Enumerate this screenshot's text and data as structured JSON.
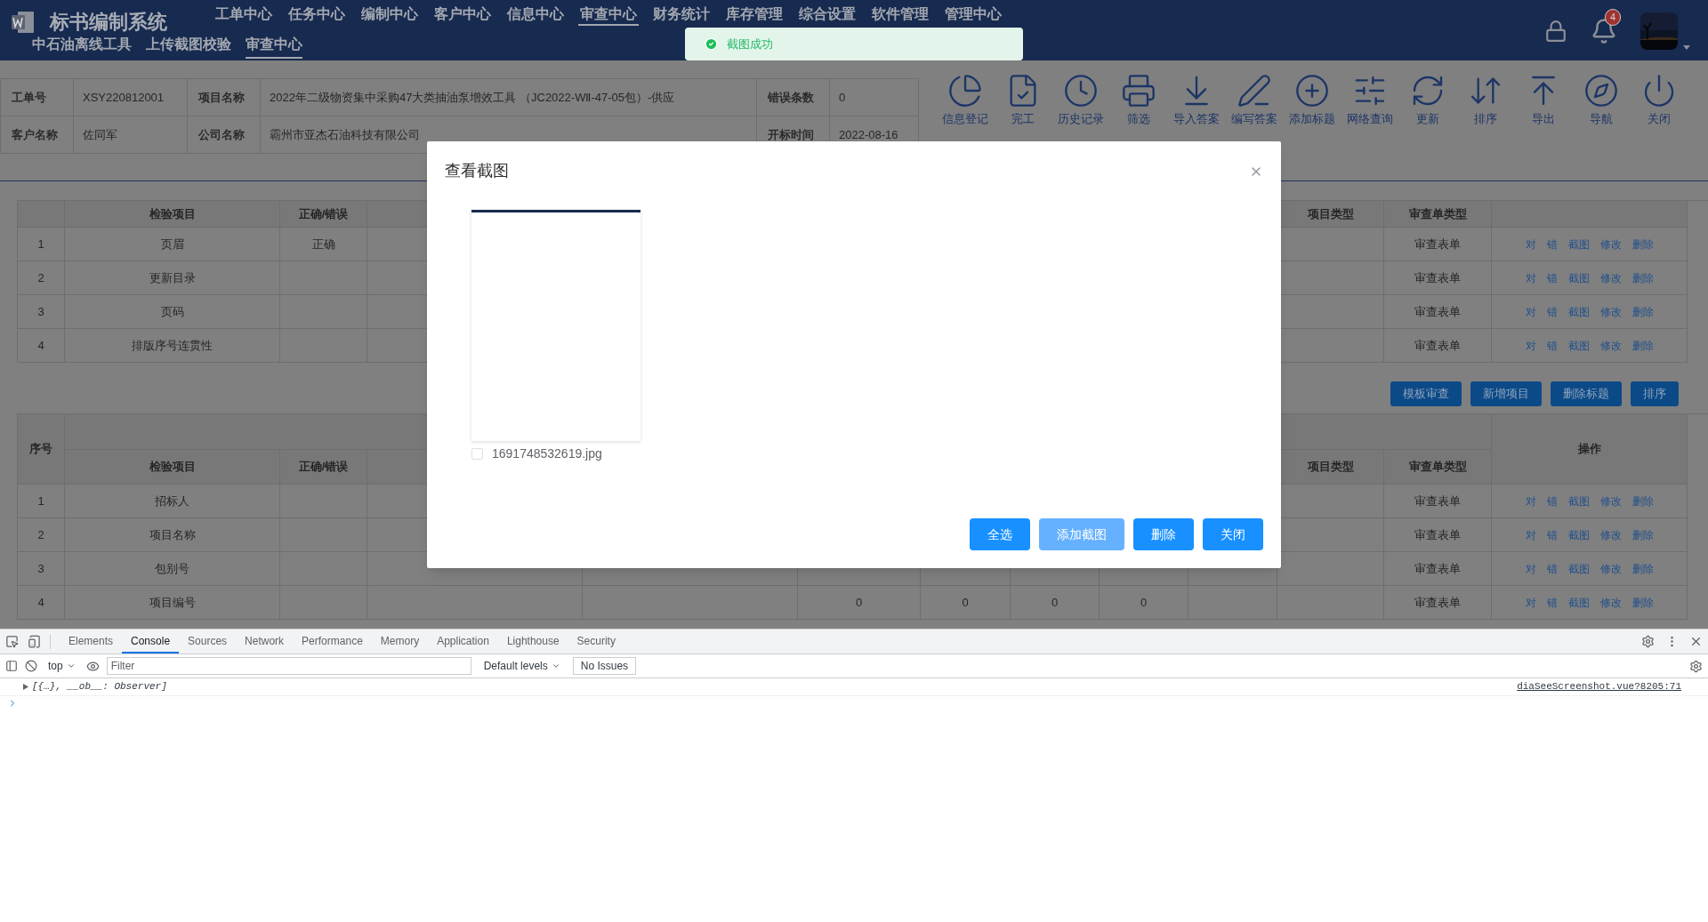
{
  "app": {
    "title": "标书编制系统"
  },
  "nav": [
    {
      "label": "工单中心",
      "selected": false
    },
    {
      "label": "任务中心",
      "selected": false
    },
    {
      "label": "编制中心",
      "selected": false
    },
    {
      "label": "客户中心",
      "selected": false
    },
    {
      "label": "信息中心",
      "selected": false
    },
    {
      "label": "审查中心",
      "selected": true
    },
    {
      "label": "财务统计",
      "selected": false
    },
    {
      "label": "库存管理",
      "selected": false
    },
    {
      "label": "综合设置",
      "selected": false
    },
    {
      "label": "软件管理",
      "selected": false
    },
    {
      "label": "管理中心",
      "selected": false
    }
  ],
  "subnav": [
    {
      "label": "中石油离线工具",
      "selected": false
    },
    {
      "label": "上传截图校验",
      "selected": false
    },
    {
      "label": "审查中心",
      "selected": true
    }
  ],
  "notifications": {
    "count": "4"
  },
  "info": [
    [
      {
        "label": "工单号",
        "value": "XSY220812001"
      },
      {
        "label": "项目名称",
        "value": "2022年二级物资集中采购47大类抽油泵增效工具 （JC2022-WⅡ-47-05包）-供应"
      },
      {
        "label": "错误条数",
        "value": "0"
      }
    ],
    [
      {
        "label": "客户名称",
        "value": "佐同军"
      },
      {
        "label": "公司名称",
        "value": "霸州市亚杰石油科技有限公司"
      },
      {
        "label": "开标时间",
        "value": "2022-08-16"
      }
    ]
  ],
  "toolbar": [
    {
      "label": "信息登记",
      "kind": "pie"
    },
    {
      "label": "完工",
      "kind": "doc"
    },
    {
      "label": "历史记录",
      "kind": "clock"
    },
    {
      "label": "筛选",
      "kind": "printer"
    },
    {
      "label": "导入答案",
      "kind": "download"
    },
    {
      "label": "编写答案",
      "kind": "pen"
    },
    {
      "label": "添加标题",
      "kind": "plus"
    },
    {
      "label": "网络查询",
      "kind": "sliders"
    },
    {
      "label": "更新",
      "kind": "refresh"
    },
    {
      "label": "排序",
      "kind": "sort"
    },
    {
      "label": "导出",
      "kind": "upload"
    },
    {
      "label": "导航",
      "kind": "compass"
    },
    {
      "label": "关闭",
      "kind": "power"
    }
  ],
  "table1": {
    "headers": {
      "item": "检验项目",
      "result": "正确/错误",
      "project_type": "项目类型",
      "form_type": "审查单类型"
    },
    "rows": [
      {
        "no": "1",
        "item": "页眉",
        "result": "正确",
        "form_type": "审查表单",
        "actions": [
          "对",
          "错",
          "截图",
          "修改",
          "删除"
        ]
      },
      {
        "no": "2",
        "item": "更新目录",
        "form_type": "审查表单",
        "actions": [
          "对",
          "错",
          "截图",
          "修改",
          "删除"
        ]
      },
      {
        "no": "3",
        "item": "页码",
        "form_type": "审查表单",
        "actions": [
          "对",
          "错",
          "截图",
          "修改",
          "删除"
        ]
      },
      {
        "no": "4",
        "item": "排版序号连贯性",
        "form_type": "审查表单",
        "actions": [
          "对",
          "错",
          "截图",
          "修改",
          "删除"
        ]
      }
    ]
  },
  "table_buttons": [
    "模板审查",
    "新增项目",
    "删除标题",
    "排序"
  ],
  "table2": {
    "headers": {
      "no": "序号",
      "item": "检验项目",
      "result": "正确/错误",
      "project_type": "项目类型",
      "form_type": "审查单类型",
      "actions": "操作"
    },
    "rows": [
      {
        "no": "1",
        "item": "招标人",
        "form_type": "审查表单",
        "actions": [
          "对",
          "错",
          "截图",
          "修改",
          "删除"
        ]
      },
      {
        "no": "2",
        "item": "项目名称",
        "form_type": "审查表单",
        "actions": [
          "对",
          "错",
          "截图",
          "修改",
          "删除"
        ]
      },
      {
        "no": "3",
        "item": "包别号",
        "form_type": "审查表单",
        "actions": [
          "对",
          "错",
          "截图",
          "修改",
          "删除"
        ]
      },
      {
        "no": "4",
        "item": "项目编号",
        "counts": [
          "0",
          "0",
          "0",
          "0"
        ],
        "form_type": "审查表单",
        "actions": [
          "对",
          "错",
          "截图",
          "修改",
          "删除"
        ]
      }
    ]
  },
  "modal": {
    "title": "查看截图",
    "images": [
      {
        "filename": "1691748532619.jpg",
        "checked": false
      }
    ],
    "buttons": [
      {
        "label": "全选",
        "kind": "primary"
      },
      {
        "label": "添加截图",
        "kind": "light"
      },
      {
        "label": "删除",
        "kind": "primary"
      },
      {
        "label": "关闭",
        "kind": "primary"
      }
    ]
  },
  "toast": {
    "text": "截图成功",
    "kind": "success"
  },
  "devtools": {
    "tabs": [
      {
        "label": "Elements",
        "selected": false
      },
      {
        "label": "Console",
        "selected": true
      },
      {
        "label": "Sources",
        "selected": false
      },
      {
        "label": "Network",
        "selected": false
      },
      {
        "label": "Performance",
        "selected": false
      },
      {
        "label": "Memory",
        "selected": false
      },
      {
        "label": "Application",
        "selected": false
      },
      {
        "label": "Lighthouse",
        "selected": false
      },
      {
        "label": "Security",
        "selected": false
      }
    ],
    "context": "top",
    "filter_placeholder": "Filter",
    "levels": "Default levels",
    "issues": "No Issues",
    "log": {
      "text": "[{…}, __ob__: Observer]",
      "source": "diaSeeScreenshot.vue?8205:71",
      "expanded": false
    }
  }
}
